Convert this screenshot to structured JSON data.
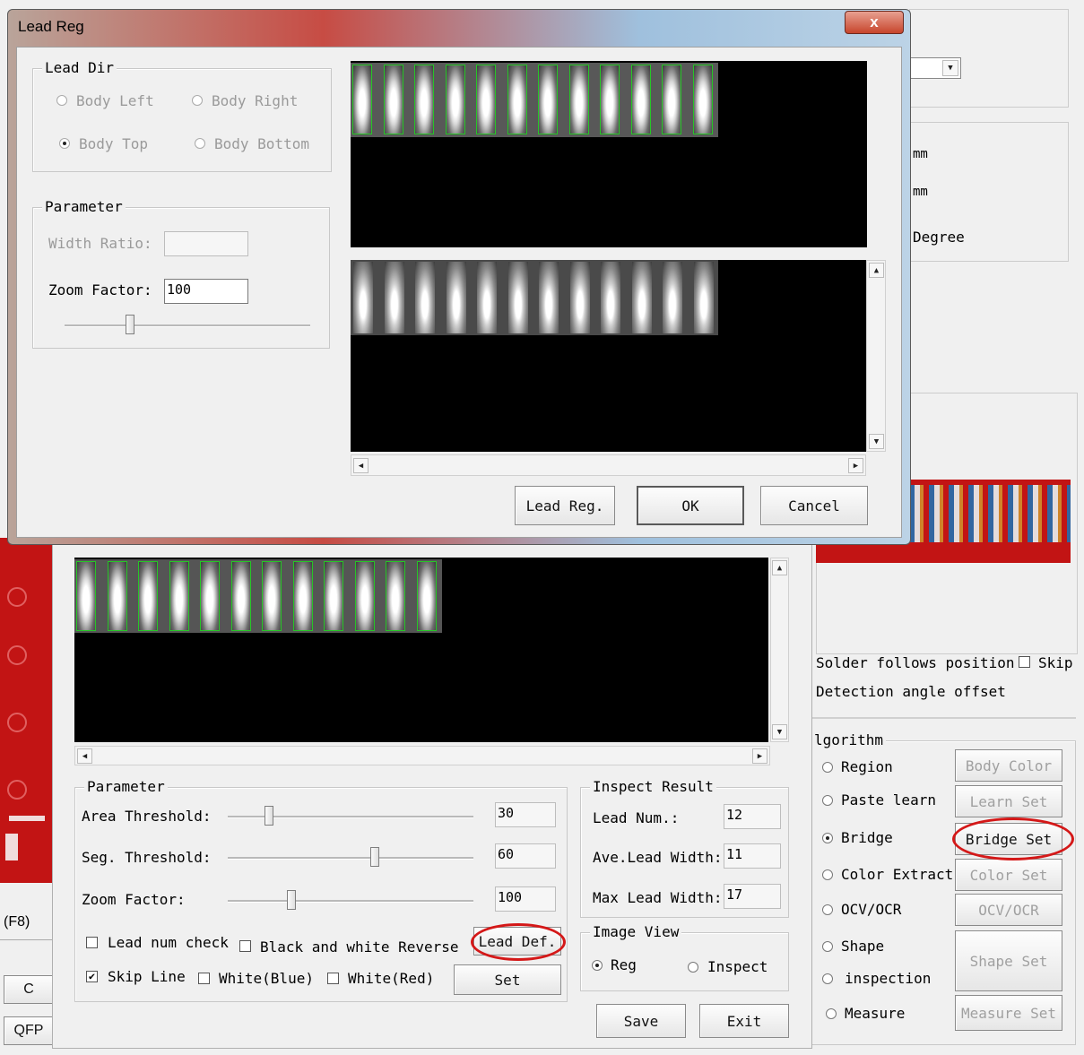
{
  "lead_reg_dialog": {
    "title": "Lead Reg",
    "close_label": "x",
    "lead_dir": {
      "label": "Lead Dir",
      "options": [
        "Body Left",
        "Body Right",
        "Body Top",
        "Body Bottom"
      ],
      "selected": "Body Top"
    },
    "parameter": {
      "label": "Parameter",
      "width_ratio_label": "Width Ratio:",
      "width_ratio_value": "",
      "zoom_factor_label": "Zoom Factor:",
      "zoom_factor_value": "100"
    },
    "buttons": {
      "lead_reg": "Lead Reg.",
      "ok": "OK",
      "cancel": "Cancel"
    }
  },
  "inspect_panel": {
    "parameter": {
      "label": "Parameter",
      "area_threshold_label": "Area Threshold:",
      "area_threshold_value": "30",
      "seg_threshold_label": "Seg. Threshold:",
      "seg_threshold_value": "60",
      "zoom_factor_label": "Zoom Factor:",
      "zoom_factor_value": "100",
      "lead_num_check": "Lead num check",
      "bw_reverse": "Black and white Reverse",
      "skip_line": "Skip Line",
      "white_blue": "White(Blue)",
      "white_red": "White(Red)",
      "lead_def_button": "Lead Def.",
      "set_button": "Set"
    },
    "inspect_result": {
      "label": "Inspect Result",
      "lead_num_label": "Lead Num.:",
      "lead_num_value": "12",
      "ave_lead_width_label": "Ave.Lead Width:",
      "ave_lead_width_value": "11",
      "max_lead_width_label": "Max Lead Width:",
      "max_lead_width_value": "17"
    },
    "image_view": {
      "label": "Image View",
      "options": [
        "Reg",
        "Inspect"
      ],
      "selected": "Reg"
    },
    "save_button": "Save",
    "exit_button": "Exit"
  },
  "right_panel": {
    "units": [
      "mm",
      "mm",
      "Degree"
    ],
    "solder_follows": "Solder follows position",
    "skip": "Skip",
    "detection_angle": "Detection angle offset",
    "algorithm": {
      "label": "lgorithm",
      "options": [
        "Region",
        "Paste learn",
        "Bridge",
        "Color Extract",
        "OCV/OCR",
        "Shape",
        "inspection",
        "Measure"
      ],
      "selected": "Bridge",
      "buttons": [
        "Body Color",
        "Learn Set",
        "Bridge Set",
        "Color Set",
        "OCV/OCR",
        "Shape Set",
        "Measure Set"
      ]
    }
  },
  "left_strip": {
    "f8": "(F8)",
    "c": "C",
    "qfp": "QFP"
  },
  "colors": {
    "highlight_ring": "#d41818",
    "lead_outline": "#26c626",
    "pcb_red": "#c21414"
  }
}
